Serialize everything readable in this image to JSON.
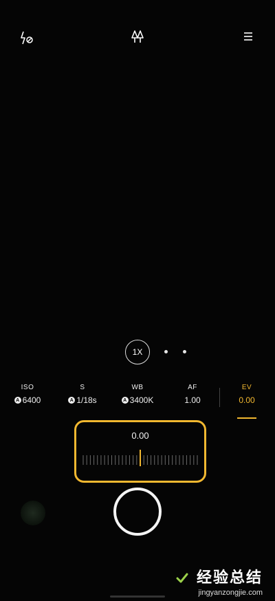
{
  "topbar": {
    "flash_icon": "flash-off-icon",
    "mode_icon": "trees-icon",
    "menu_icon": "menu-icon"
  },
  "zoom": {
    "label": "1X",
    "dot_count": 2
  },
  "params": [
    {
      "key": "iso",
      "name": "ISO",
      "value": "6400",
      "auto": true,
      "active": false
    },
    {
      "key": "s",
      "name": "S",
      "value": "1/18s",
      "auto": true,
      "active": false
    },
    {
      "key": "wb",
      "name": "WB",
      "value": "3400K",
      "auto": true,
      "active": false
    },
    {
      "key": "af",
      "name": "AF",
      "value": "1.00",
      "auto": false,
      "active": false
    },
    {
      "key": "ev",
      "name": "EV",
      "value": "0.00",
      "auto": false,
      "active": true
    }
  ],
  "ev_slider": {
    "value": "0.00",
    "position": 0.5
  },
  "watermark": {
    "title": "经验总结",
    "url": "jingyanzongjie.com"
  },
  "colors": {
    "accent": "#f2b830",
    "background": "#050505",
    "foreground": "#f0f0f0"
  }
}
